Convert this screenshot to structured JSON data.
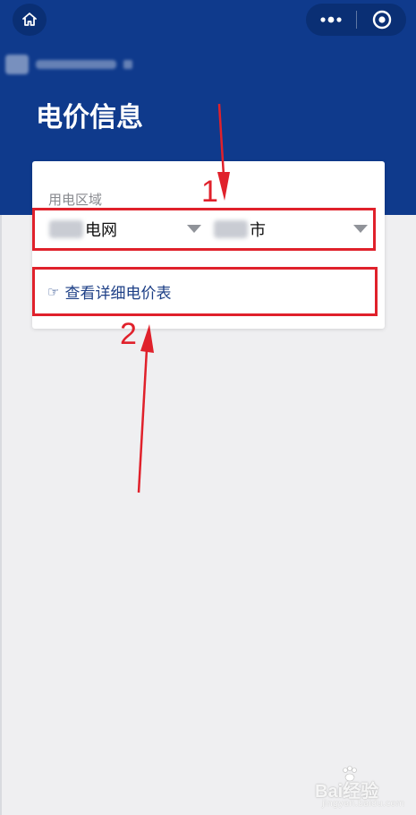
{
  "page": {
    "title": "电价信息"
  },
  "region": {
    "label": "用电区域",
    "grid_suffix": "电网",
    "city_suffix": "市"
  },
  "link": {
    "icon_glyph": "☞",
    "label": "查看详细电价表"
  },
  "annotations": {
    "marker_1": "1",
    "marker_2": "2"
  },
  "watermark": {
    "brand": "Bai经验",
    "url": "jingyan.baidu.com"
  },
  "colors": {
    "header_bg": "#0f3a8c",
    "annotation_red": "#e0212b",
    "link_blue": "#1d3f86"
  },
  "icons": [
    "home-icon",
    "more-dots-icon",
    "close-circle-icon",
    "caret-down-icon",
    "pointing-hand-icon"
  ]
}
